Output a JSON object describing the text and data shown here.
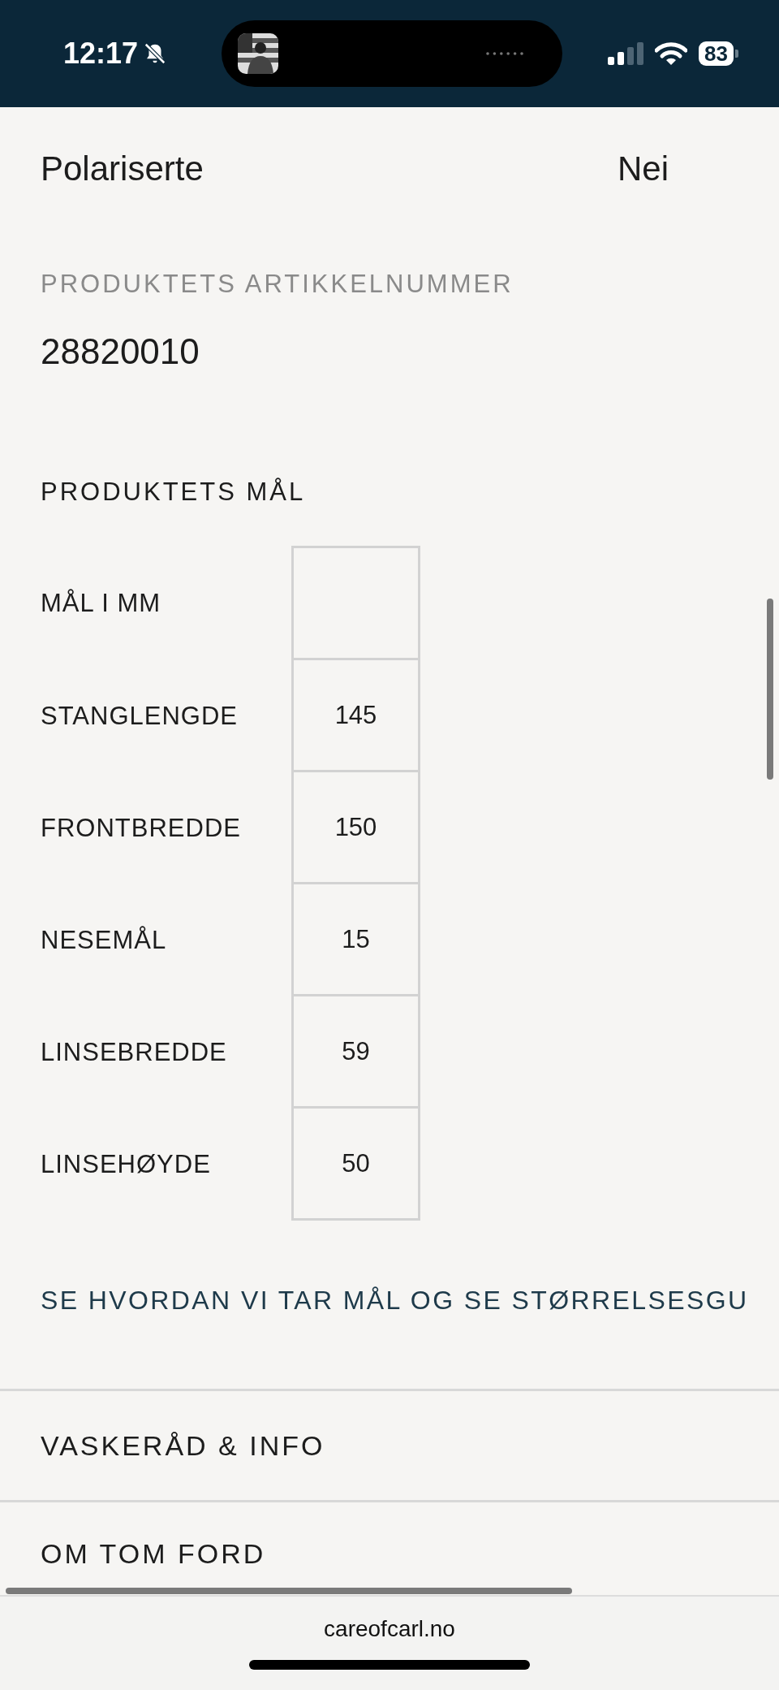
{
  "status_bar": {
    "time": "12:17",
    "battery": "83"
  },
  "spec_row": {
    "label": "Polariserte",
    "value": "Nei"
  },
  "article": {
    "heading": "PRODUKTETS ARTIKKELNUMMER",
    "value": "28820010"
  },
  "dimensions": {
    "heading": "PRODUKTETS MÅL",
    "rows": [
      {
        "label": "MÅL I MM"
      },
      {
        "label": "STANGLENGDE",
        "value": "145"
      },
      {
        "label": "FRONTBREDDE",
        "value": "150"
      },
      {
        "label": "NESEMÅL",
        "value": "15"
      },
      {
        "label": "LINSEBREDDE",
        "value": "59"
      },
      {
        "label": "LINSEHØYDE",
        "value": "50"
      }
    ]
  },
  "size_guide_link": "SE HVORDAN VI TAR MÅL OG SE STØRRELSESGU",
  "accordions": [
    "VASKERÅD & INFO",
    "OM TOM FORD"
  ],
  "browser_bar": {
    "url": "careofcarl.no"
  }
}
